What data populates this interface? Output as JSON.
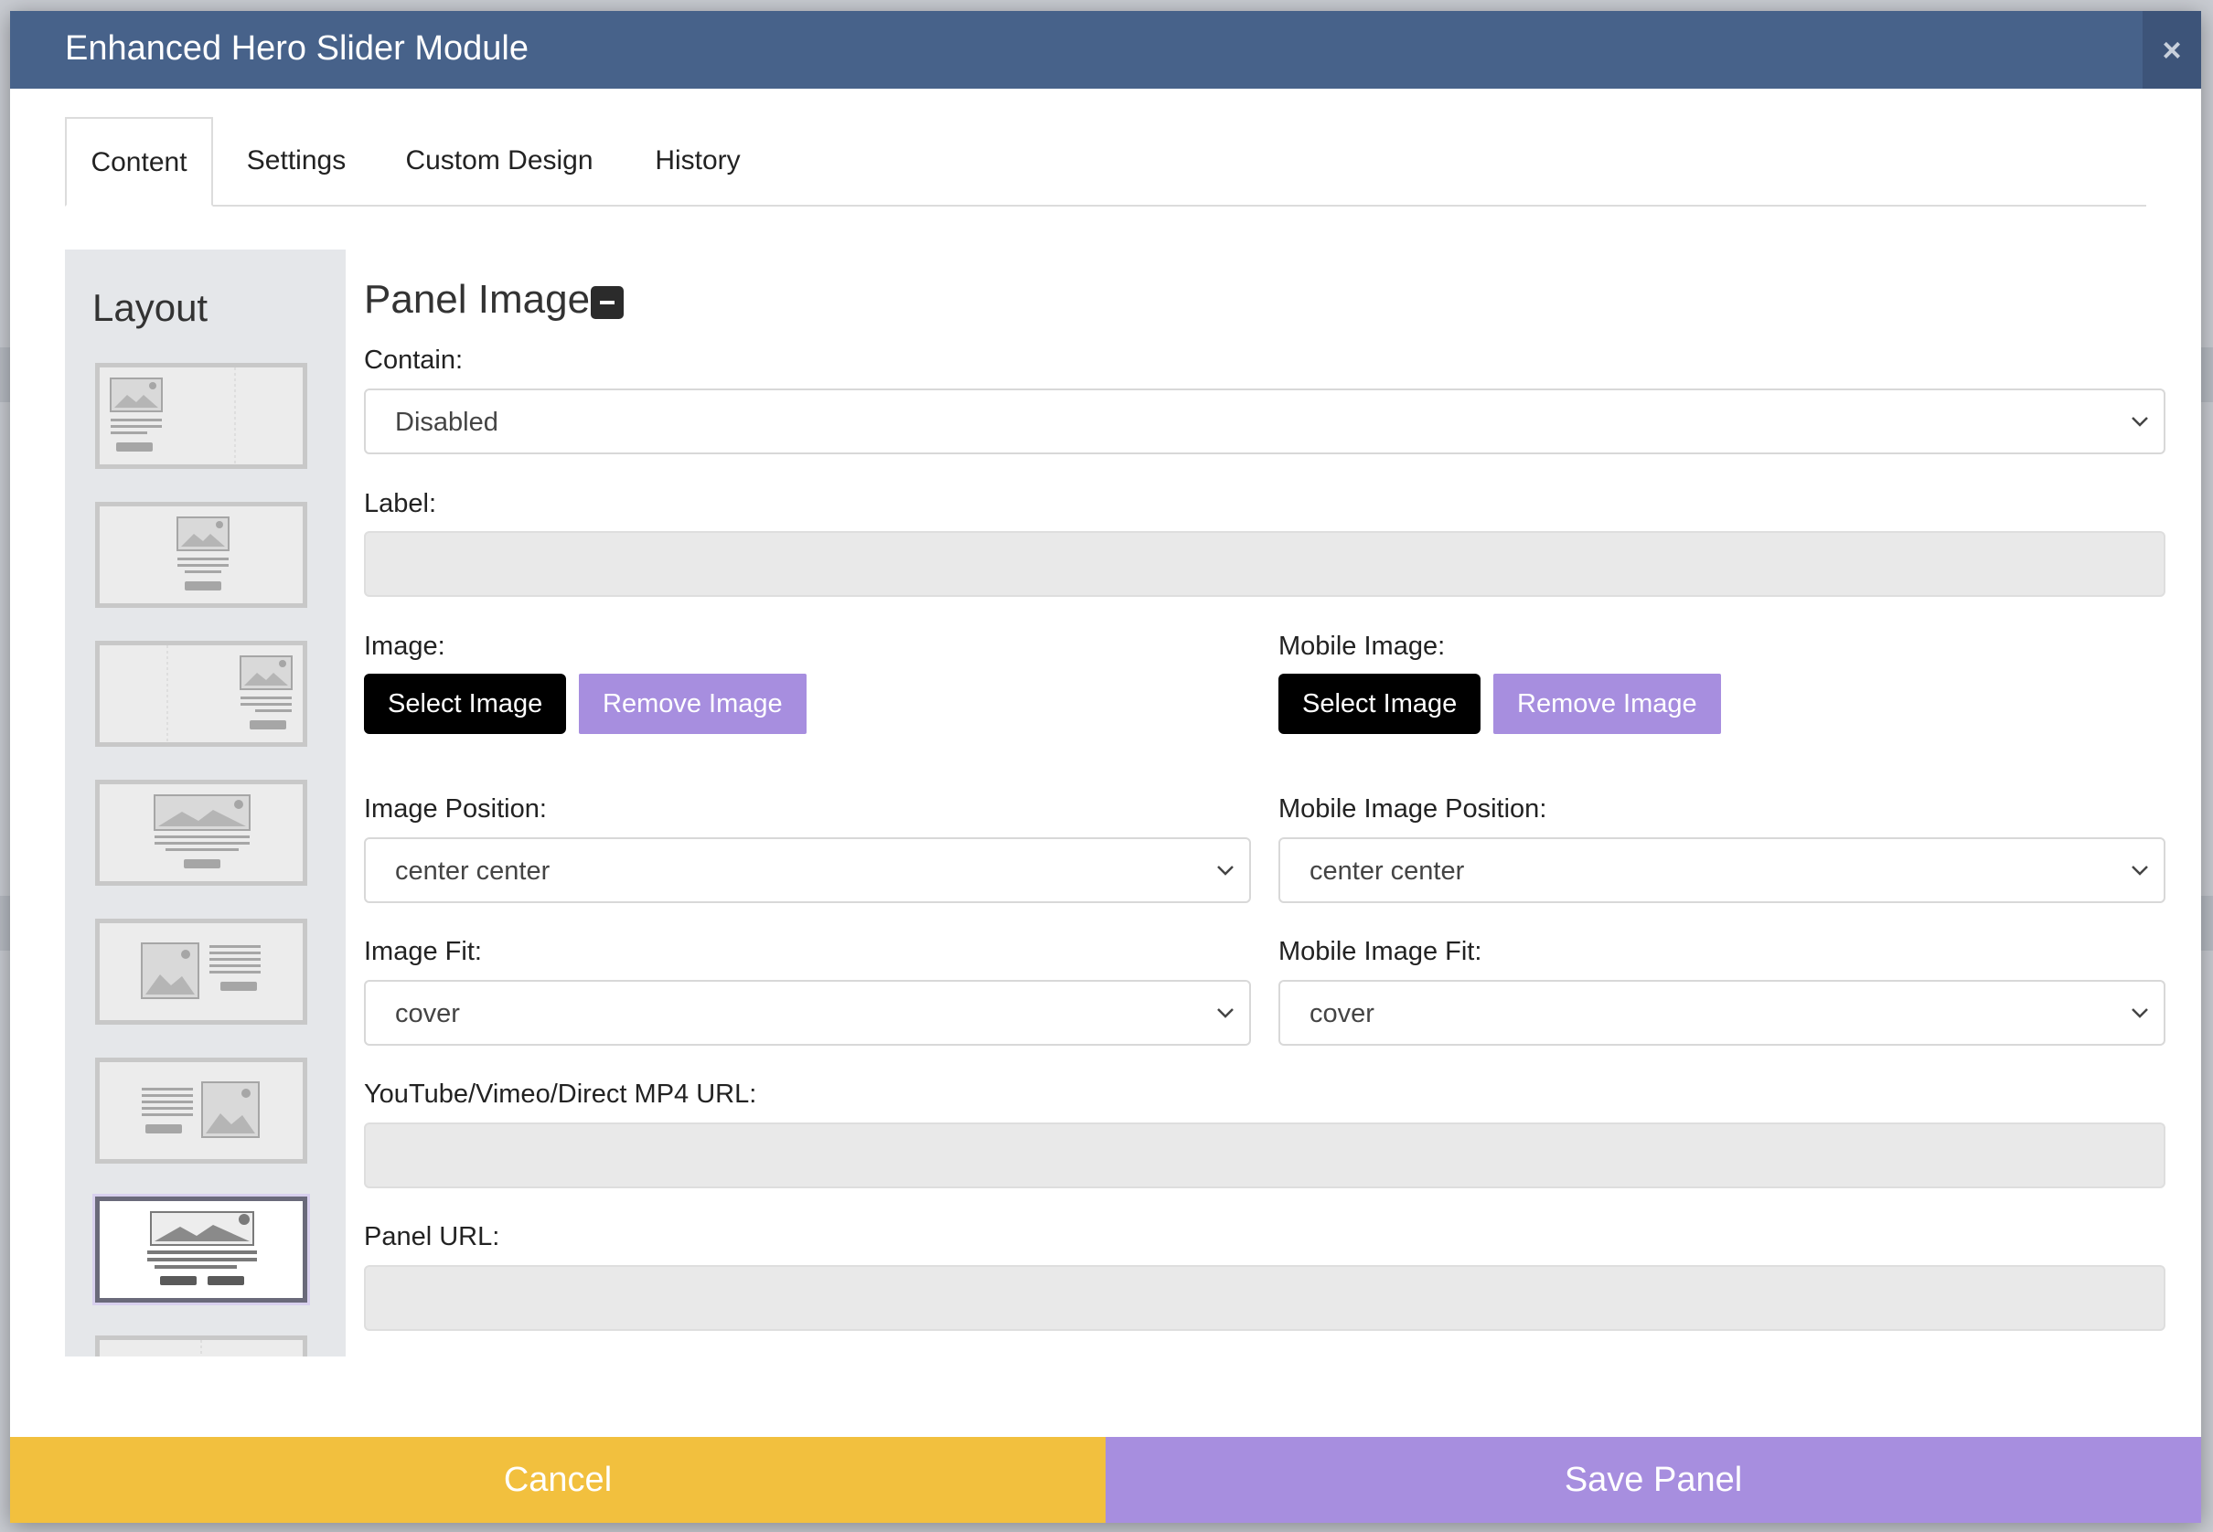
{
  "window": {
    "title": "Enhanced Hero Slider Module",
    "close_icon": "×"
  },
  "tabs": [
    {
      "label": "Content",
      "active": true
    },
    {
      "label": "Settings",
      "active": false
    },
    {
      "label": "Custom Design",
      "active": false
    },
    {
      "label": "History",
      "active": false
    }
  ],
  "layout": {
    "title": "Layout",
    "options": [
      {
        "name": "image-text-left"
      },
      {
        "name": "image-text-center"
      },
      {
        "name": "image-text-right"
      },
      {
        "name": "wide-image-text-center"
      },
      {
        "name": "image-left-text-right"
      },
      {
        "name": "text-left-image-right"
      },
      {
        "name": "wide-image-two-buttons",
        "selected": true
      },
      {
        "name": "split-columns"
      }
    ]
  },
  "panel_image": {
    "section_title": "Panel Image",
    "contain": {
      "label": "Contain:",
      "value": "Disabled"
    },
    "label_field": {
      "label": "Label:",
      "value": ""
    },
    "image": {
      "label": "Image:",
      "select_label": "Select Image",
      "remove_label": "Remove Image"
    },
    "mobile_image": {
      "label": "Mobile Image:",
      "select_label": "Select Image",
      "remove_label": "Remove Image"
    },
    "image_position": {
      "label": "Image Position:",
      "value": "center center"
    },
    "mobile_image_position": {
      "label": "Mobile Image Position:",
      "value": "center center"
    },
    "image_fit": {
      "label": "Image Fit:",
      "value": "cover"
    },
    "mobile_image_fit": {
      "label": "Mobile Image Fit:",
      "value": "cover"
    },
    "video_url": {
      "label": "YouTube/Vimeo/Direct MP4 URL:",
      "value": ""
    },
    "panel_url": {
      "label": "Panel URL:",
      "value": ""
    }
  },
  "footer": {
    "cancel_label": "Cancel",
    "save_label": "Save Panel"
  },
  "colors": {
    "titlebar": "#47628a",
    "cancel": "#f2c03e",
    "save": "#a78edf",
    "remove_button": "#a78edf"
  }
}
